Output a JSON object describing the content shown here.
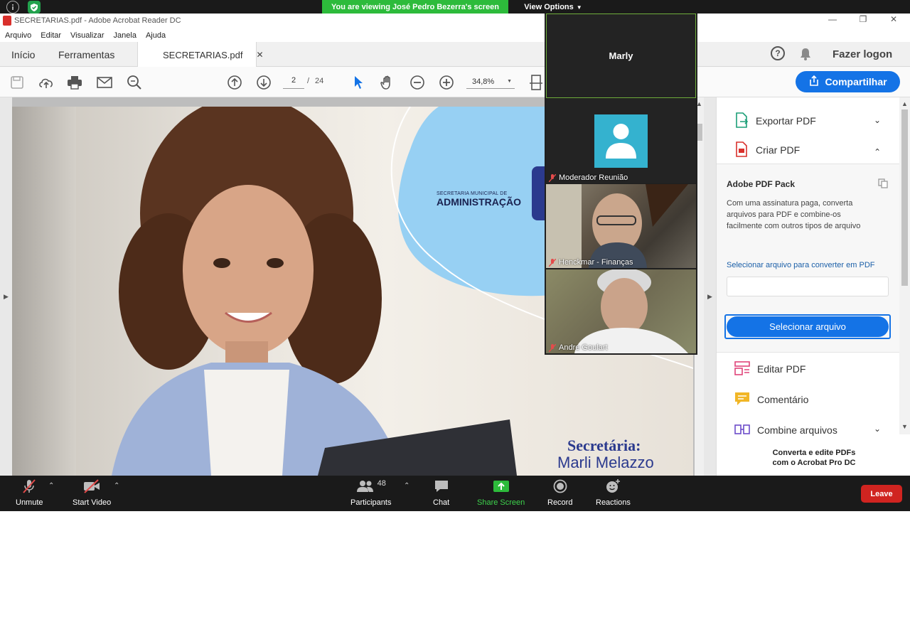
{
  "zoom": {
    "banner": "You are viewing José Pedro Bezerra's screen",
    "view_options": "View Options",
    "participants": [
      {
        "name": "Marly"
      },
      {
        "name": "Moderador Reunião"
      },
      {
        "name": "Henckmar - Finanças"
      },
      {
        "name": "Andre Goulart"
      }
    ],
    "toolbar": {
      "unmute": "Unmute",
      "start_video": "Start Video",
      "participants": "Participants",
      "participants_count": "48",
      "chat": "Chat",
      "share_screen": "Share Screen",
      "record": "Record",
      "reactions": "Reactions",
      "leave": "Leave"
    },
    "colors": {
      "share_green": "#2dbb3b",
      "leave_red": "#d02420"
    }
  },
  "acrobat": {
    "window_title": "SECRETARIAS.pdf - Adobe Acrobat Reader DC",
    "menu": [
      "Arquivo",
      "Editar",
      "Visualizar",
      "Janela",
      "Ajuda"
    ],
    "tabs": {
      "home": "Início",
      "tools": "Ferramentas",
      "doc": "SECRETARIAS.pdf"
    },
    "login": "Fazer logon",
    "page_current": "2",
    "page_sep": "/",
    "page_total": "24",
    "zoom_level": "34,8%",
    "share": "Compartilhar",
    "right_pane": {
      "export_pdf": "Exportar PDF",
      "create_pdf": "Criar PDF",
      "pack_title": "Adobe PDF Pack",
      "pack_desc": "Com uma assinatura paga, converta arquivos para PDF e combine-os facilmente com outros tipos de arquivo",
      "pack_link": "Selecionar arquivo para converter em PDF",
      "pack_button": "Selecionar arquivo",
      "edit_pdf": "Editar PDF",
      "comment": "Comentário",
      "combine": "Combine arquivos",
      "promo_line1": "Converta e edite PDFs",
      "promo_line2": "com o Acrobat Pro DC"
    },
    "accent": "#1473e6"
  },
  "slide": {
    "dept_small": "SECRETARIA MUNICIPAL DE",
    "dept_big": "ADMINISTRAÇÃO",
    "role": "Secretária:",
    "person": "Marli Melazzo"
  }
}
